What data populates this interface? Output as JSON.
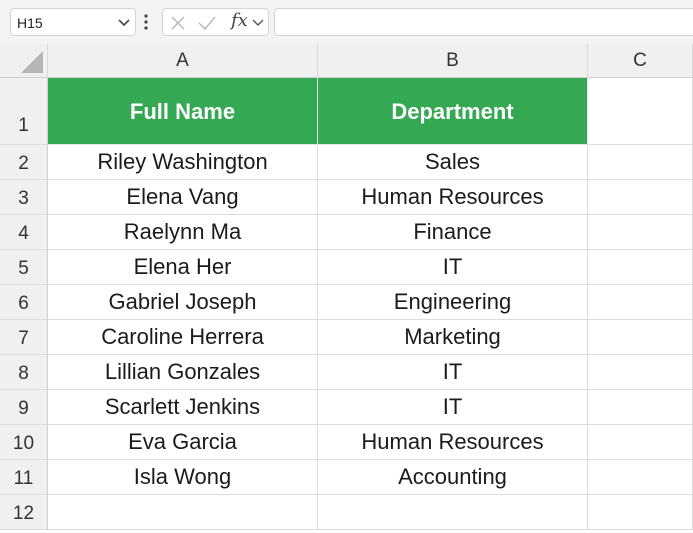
{
  "formula_bar": {
    "name_box": "H15",
    "fx_label": "fx",
    "formula": ""
  },
  "columns": [
    "A",
    "B",
    "C"
  ],
  "rows": [
    "1",
    "2",
    "3",
    "4",
    "5",
    "6",
    "7",
    "8",
    "9",
    "10",
    "11",
    "12"
  ],
  "header": {
    "a": "Full Name",
    "b": "Department"
  },
  "data": [
    {
      "a": "Riley Washington",
      "b": "Sales"
    },
    {
      "a": "Elena Vang",
      "b": "Human Resources"
    },
    {
      "a": "Raelynn Ma",
      "b": "Finance"
    },
    {
      "a": "Elena Her",
      "b": "IT"
    },
    {
      "a": "Gabriel Joseph",
      "b": "Engineering"
    },
    {
      "a": "Caroline Herrera",
      "b": "Marketing"
    },
    {
      "a": "Lillian Gonzales",
      "b": "IT"
    },
    {
      "a": "Scarlett Jenkins",
      "b": "IT"
    },
    {
      "a": "Eva Garcia",
      "b": "Human Resources"
    },
    {
      "a": "Isla Wong",
      "b": "Accounting"
    }
  ],
  "colors": {
    "header_fill": "#34a853",
    "header_text": "#ffffff"
  }
}
